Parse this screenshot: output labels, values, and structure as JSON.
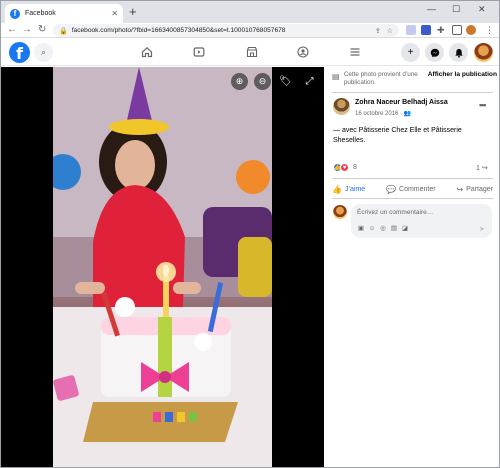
{
  "browser": {
    "tab_title": "Facebook",
    "tab_favicon": "f",
    "new_tab_label": "+",
    "url": "facebook.com/photo/?fbid=1663400857304850&set=t.100010768057678"
  },
  "photo_viewer": {
    "controls": [
      "zoom-in",
      "zoom-out",
      "tag",
      "fullscreen"
    ]
  },
  "post": {
    "notice_text": "Cette photo provient d’une publication.",
    "notice_link": "Afficher la publication",
    "author": "Zohra Naceur Belhadj Aissa",
    "date": "16 octobre 2016 ·",
    "caption_prefix": "— avec ",
    "tag1": "Pâtisserie Chez Elle",
    "caption_and": " et ",
    "tag2": "Pâtisserie Sheselles",
    "caption_suffix": ".",
    "reaction_count": "8",
    "share_count": "1",
    "like_label": "J’aime",
    "comment_label": "Commenter",
    "share_label": "Partager",
    "comment_placeholder": "Écrivez un commentaire…"
  },
  "colors": {
    "facebook_blue": "#1877f2",
    "love_red": "#f33e58"
  }
}
